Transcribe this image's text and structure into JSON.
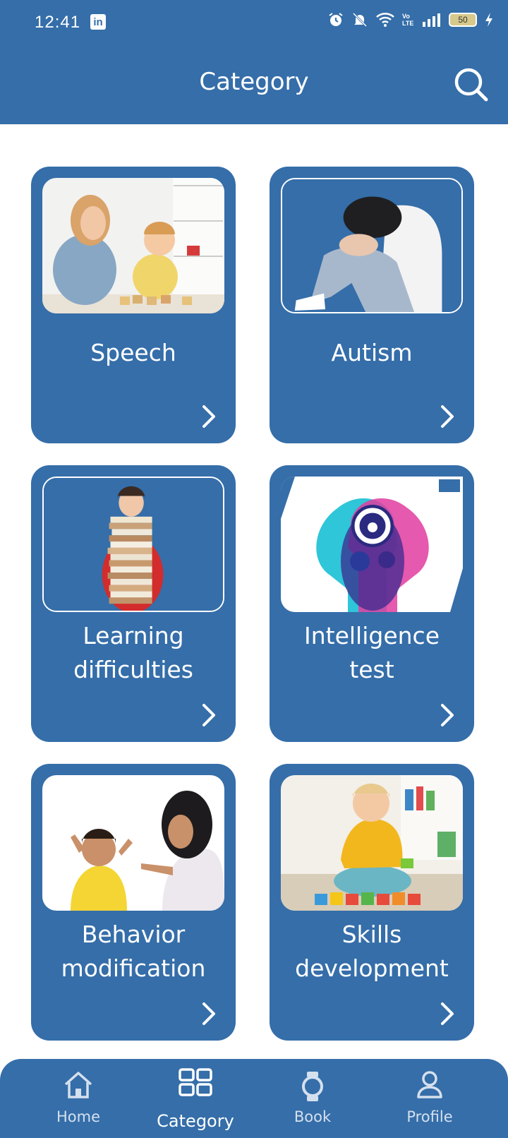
{
  "status_bar": {
    "time": "12:41",
    "battery": "50",
    "network": "Vo LTE"
  },
  "header": {
    "title": "Category"
  },
  "icons": {
    "search": "search-icon",
    "chevron": "chevron-right-icon"
  },
  "colors": {
    "primary": "#356ea9",
    "background": "#ffffff",
    "text_on_primary": "#ffffff"
  },
  "categories": [
    {
      "title": "Speech"
    },
    {
      "title": "Autism"
    },
    {
      "title": "Learning\ndifficulties"
    },
    {
      "title": "Intelligence\ntest"
    },
    {
      "title": "Behavior\nmodification"
    },
    {
      "title": "Skills\ndevelopment"
    }
  ],
  "bottom_nav": {
    "items": [
      {
        "label": "Home",
        "icon": "home-icon"
      },
      {
        "label": "Category",
        "icon": "grid-icon",
        "active": true
      },
      {
        "label": "Book",
        "icon": "watch-icon"
      },
      {
        "label": "Profile",
        "icon": "user-icon"
      }
    ]
  }
}
